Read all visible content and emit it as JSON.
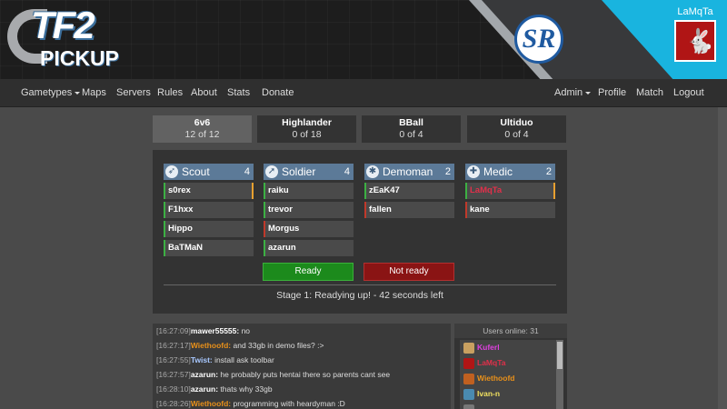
{
  "brand": {
    "logo_tf": "TF2",
    "logo_pickup": "PICKUP",
    "sponsor": "SR"
  },
  "user": {
    "name": "LaMqTa"
  },
  "nav": {
    "gametypes": "Gametypes",
    "maps": "Maps",
    "servers": "Servers",
    "rules": "Rules",
    "about": "About",
    "stats": "Stats",
    "donate": "Donate",
    "admin": "Admin",
    "profile": "Profile",
    "match": "Match",
    "logout": "Logout"
  },
  "gametypes": [
    {
      "name": "6v6",
      "count": "12 of 12"
    },
    {
      "name": "Highlander",
      "count": "0 of 18"
    },
    {
      "name": "BBall",
      "count": "0 of 4"
    },
    {
      "name": "Ultiduo",
      "count": "0 of 4"
    }
  ],
  "classes": [
    {
      "name": "Scout",
      "count": "4",
      "icon": "scout-icon",
      "players": [
        {
          "name": "s0rex",
          "status_color": "#3cb043",
          "right_marker": true,
          "name_color": "#ffffff"
        },
        {
          "name": "F1hxx",
          "status_color": "#3cb043",
          "right_marker": false,
          "name_color": "#ffffff"
        },
        {
          "name": "Hippo",
          "status_color": "#3cb043",
          "right_marker": false,
          "name_color": "#ffffff"
        },
        {
          "name": "BaTMaN",
          "status_color": "#3cb043",
          "right_marker": false,
          "name_color": "#ffffff"
        }
      ]
    },
    {
      "name": "Soldier",
      "count": "4",
      "icon": "soldier-icon",
      "players": [
        {
          "name": "raiku",
          "status_color": "#3cb043",
          "right_marker": false,
          "name_color": "#ffffff"
        },
        {
          "name": "trevor",
          "status_color": "#3cb043",
          "right_marker": false,
          "name_color": "#ffffff"
        },
        {
          "name": "Morgus",
          "status_color": "#c0392b",
          "right_marker": false,
          "name_color": "#ffffff"
        },
        {
          "name": "azarun",
          "status_color": "#3cb043",
          "right_marker": false,
          "name_color": "#ffffff"
        }
      ]
    },
    {
      "name": "Demoman",
      "count": "2",
      "icon": "demoman-icon",
      "players": [
        {
          "name": "zEaK47",
          "status_color": "#3cb043",
          "right_marker": false,
          "name_color": "#ffffff"
        },
        {
          "name": "fallen",
          "status_color": "#c0392b",
          "right_marker": false,
          "name_color": "#ffffff"
        }
      ]
    },
    {
      "name": "Medic",
      "count": "2",
      "icon": "medic-icon",
      "players": [
        {
          "name": "LaMqTa",
          "status_color": "#3cb043",
          "right_marker": true,
          "name_color": "#e0304a"
        },
        {
          "name": "kane",
          "status_color": "#c0392b",
          "right_marker": false,
          "name_color": "#ffffff"
        }
      ]
    }
  ],
  "buttons": {
    "ready": "Ready",
    "not_ready": "Not ready"
  },
  "stage_text": "Stage 1: Readying up! - 42 seconds left",
  "chat": [
    {
      "time": "[16:27:09]",
      "name": "mawer55555:",
      "name_style": "white",
      "msg": " no"
    },
    {
      "time": "[16:27:17]",
      "name": "Wiethoofd:",
      "name_style": "orange",
      "msg": " and 33gb in demo files? :>"
    },
    {
      "time": "[16:27:55]",
      "name": "Twist:",
      "name_style": "blue",
      "msg": " install ask toolbar"
    },
    {
      "time": "[16:27:57]",
      "name": "azarun:",
      "name_style": "white",
      "msg": " he probably puts hentai there so parents cant see"
    },
    {
      "time": "[16:28:10]",
      "name": "azarun:",
      "name_style": "white",
      "msg": " thats why 33gb"
    },
    {
      "time": "[16:28:26]",
      "name": "Wiethoofd:",
      "name_style": "orange",
      "msg": " programming with heardyman :D"
    }
  ],
  "users_online": {
    "label": "Users online: 31",
    "users": [
      {
        "name": "Kuferl",
        "color": "#e040e0",
        "icon_color": "#c8a060"
      },
      {
        "name": "LaMqTa",
        "color": "#e0304a",
        "icon_color": "#b01515"
      },
      {
        "name": "Wiethoofd",
        "color": "#e8901a",
        "icon_color": "#c06020"
      },
      {
        "name": "Ivan-n",
        "color": "#f0e060",
        "icon_color": "#4a8ab0"
      },
      {
        "name": "",
        "color": "#ffffff",
        "icon_color": "#777777"
      }
    ]
  }
}
